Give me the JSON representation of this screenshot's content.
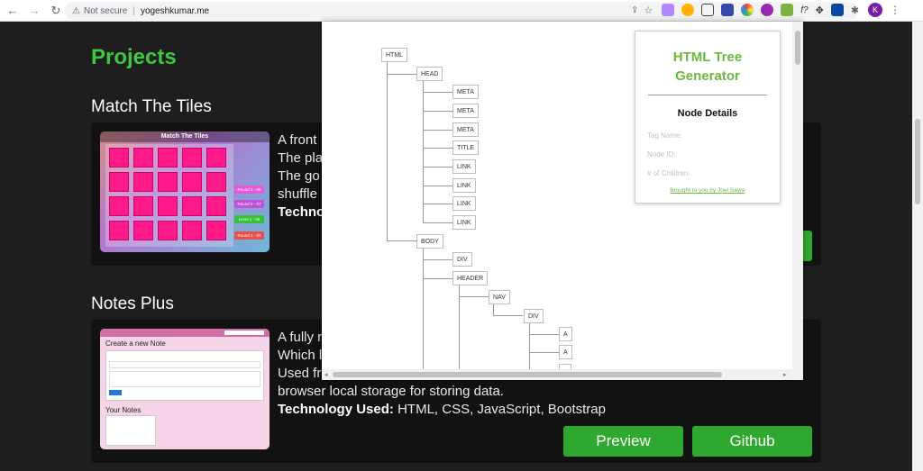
{
  "browser": {
    "back_icon": "←",
    "forward_icon": "→",
    "reload_icon": "↻",
    "security_label": "Not secure",
    "url": "yogeshkumar.me",
    "profile_initial": "K"
  },
  "page": {
    "section_title": "Projects",
    "projects": [
      {
        "title": "Match The Tiles",
        "thumb_title": "Match The Tiles",
        "desc_lines": [
          "A front",
          "The pla",
          "The go",
          "shuffle"
        ],
        "tech_label": "Techno",
        "mini_buttons": [
          "Round 1 - 00",
          "Round 2 - 07",
          "Level 1 - 05",
          "Round 1 - 03"
        ]
      },
      {
        "title": "Notes Plus",
        "thumb_create": "Create a new Note",
        "thumb_notes": "Your Notes",
        "desc_lines": [
          "A fully r",
          "Which l",
          "Used fr",
          "browser local storage for storing data."
        ],
        "tech_label": "Technology Used:",
        "tech_value": " HTML, CSS, JavaScript, Bootstrap",
        "preview_label": "Preview",
        "github_label": "Github"
      }
    ]
  },
  "tree_tool": {
    "title_line1": "HTML Tree",
    "title_line2": "Generator",
    "details_heading": "Node Details",
    "field_tag": "Tag Name:",
    "field_id": "Node ID:",
    "field_children": "# of Children:",
    "credit": "Brought to you by Joel Sayre",
    "nodes": [
      "HTML",
      "HEAD",
      "META",
      "META",
      "META",
      "TITLE",
      "LINK",
      "LINK",
      "LINK",
      "LINK",
      "BODY",
      "DIV",
      "HEADER",
      "NAV",
      "DIV",
      "A",
      "A"
    ]
  },
  "colors": {
    "accent_green": "#3ec83e",
    "button_green": "#2fa82f",
    "tree_title_green": "#6bb83f",
    "tile_pink": "#ff1a8a"
  }
}
